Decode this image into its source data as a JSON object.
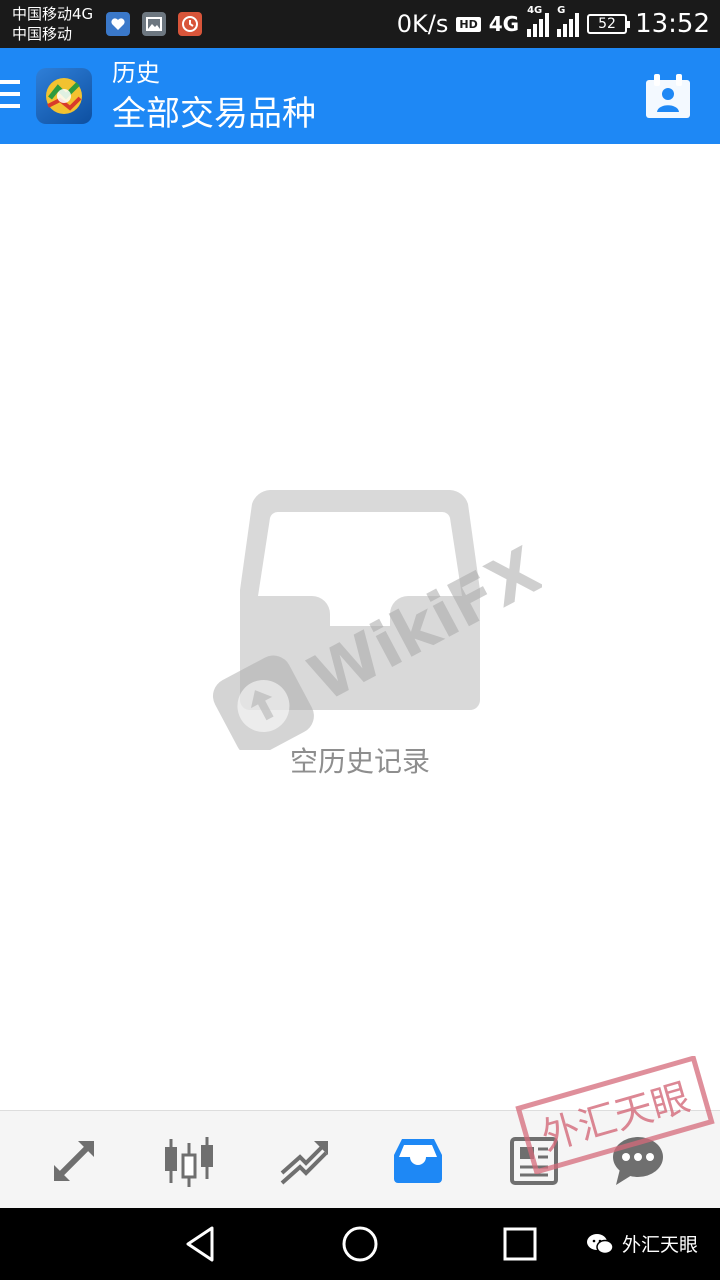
{
  "status_bar": {
    "carrier_1": "中国移动4G",
    "carrier_2": "中国移动",
    "speed": "0K/s",
    "hd": "HD",
    "network_1": "4G",
    "network_2": "4G",
    "network_3": "G",
    "battery": "52",
    "time": "13:52"
  },
  "appbar": {
    "title": "历史",
    "subtitle": "全部交易品种",
    "background": "#1e88f5"
  },
  "empty_state": {
    "label": "空历史记录",
    "icon": "inbox-icon"
  },
  "watermark": {
    "text": "WikiFX"
  },
  "tabs": [
    {
      "icon": "trade-arrows-icon",
      "active": false
    },
    {
      "icon": "candlestick-icon",
      "active": false
    },
    {
      "icon": "chart-trend-icon",
      "active": false
    },
    {
      "icon": "inbox-history-icon",
      "active": true
    },
    {
      "icon": "news-icon",
      "active": false
    },
    {
      "icon": "chat-icon",
      "active": false
    }
  ],
  "stamp": {
    "text": "外汇天眼"
  },
  "navbar": {
    "wechat_label": "外汇天眼"
  },
  "colors": {
    "accent": "#1e88f5",
    "tab_inactive": "#6f6f6f",
    "empty_icon": "#d9d9d9"
  }
}
